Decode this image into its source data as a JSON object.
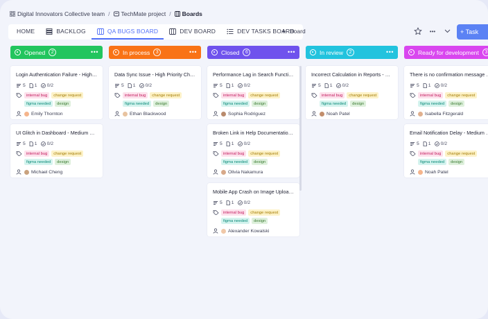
{
  "breadcrumb": {
    "team": "Digital Innovators Collective team",
    "project": "TechMate project",
    "current": "Boards",
    "separator": "/"
  },
  "nav": {
    "tabs": [
      {
        "label": "HOME",
        "active": false
      },
      {
        "label": "BACKLOG",
        "active": false
      },
      {
        "label": "QA BUGS BOARD",
        "active": true
      },
      {
        "label": "DEV BOARD",
        "active": false
      },
      {
        "label": "DEV TASKS BOARD",
        "active": false
      }
    ],
    "add_board": "Board",
    "add_task": "+ Task",
    "more": "•••"
  },
  "colors": {
    "accent": "#4f6ef7",
    "opened": "#22c55e",
    "in_process": "#f97316",
    "closed": "#6f52ed",
    "in_review": "#22c3de",
    "ready": "#d946ef"
  },
  "columns": [
    {
      "title": "Opened",
      "count": "2",
      "dots": "•••",
      "cards": [
        {
          "title": "Login Authentication Failure - High Priority",
          "subtasks": "5",
          "files": "1",
          "checks": "0/2",
          "tags": [
            "internal bug",
            "change request",
            "figma needed",
            "design"
          ],
          "assignee": "Emily Thornton"
        },
        {
          "title": "UI Glitch in Dashboard - Medium Priority",
          "subtasks": "5",
          "files": "1",
          "checks": "0/2",
          "tags": [
            "internal bug",
            "change request",
            "figma needed",
            "design"
          ],
          "assignee": "Michael Cheng"
        }
      ]
    },
    {
      "title": "In process",
      "count": "3",
      "dots": "•••",
      "cards": [
        {
          "title": "Data Sync Issue - High Priority Change Request",
          "subtasks": "5",
          "files": "1",
          "checks": "0/2",
          "tags": [
            "internal bug",
            "change request",
            "figma needed",
            "design"
          ],
          "assignee": "Ethan Blackwood"
        }
      ]
    },
    {
      "title": "Closed",
      "count": "6",
      "dots": "•••",
      "cards": [
        {
          "title": "Performance Lag in Search Function - Medium",
          "subtasks": "5",
          "files": "1",
          "checks": "0/2",
          "tags": [
            "internal bug",
            "change request",
            "figma needed",
            "design"
          ],
          "assignee": "Sophia Rodriguez"
        },
        {
          "title": "Broken Link in Help Documentation - Low",
          "subtasks": "5",
          "files": "1",
          "checks": "0/2",
          "tags": [
            "internal bug",
            "change request",
            "figma needed",
            "design"
          ],
          "assignee": "Olivia Nakamura"
        },
        {
          "title": "Mobile App Crash on Image Upload - High",
          "subtasks": "5",
          "files": "1",
          "checks": "0/2",
          "tags": [
            "internal bug",
            "change request",
            "figma needed",
            "design"
          ],
          "assignee": "Alexander Kowalski"
        }
      ]
    },
    {
      "title": "In review",
      "count": "2",
      "dots": "•••",
      "cards": [
        {
          "title": "Incorrect Calculation in Reports - High Priority",
          "subtasks": "5",
          "files": "1",
          "checks": "0/2",
          "tags": [
            "internal bug",
            "change request",
            "figma needed",
            "design"
          ],
          "assignee": "Noah Patel"
        }
      ]
    },
    {
      "title": "Ready for development",
      "count": "3",
      "dots": "•••",
      "cards": [
        {
          "title": "There is no confirmation message after saving",
          "subtasks": "5",
          "files": "1",
          "checks": "0/2",
          "tags": [
            "internal bug",
            "change request",
            "figma needed",
            "design"
          ],
          "assignee": "Isabella Fitzgerald"
        },
        {
          "title": "Email Notification Delay - Medium Priority",
          "subtasks": "5",
          "files": "1",
          "checks": "0/2",
          "tags": [
            "internal bug",
            "change request",
            "figma needed",
            "design"
          ],
          "assignee": "Noah Patel"
        }
      ]
    }
  ]
}
